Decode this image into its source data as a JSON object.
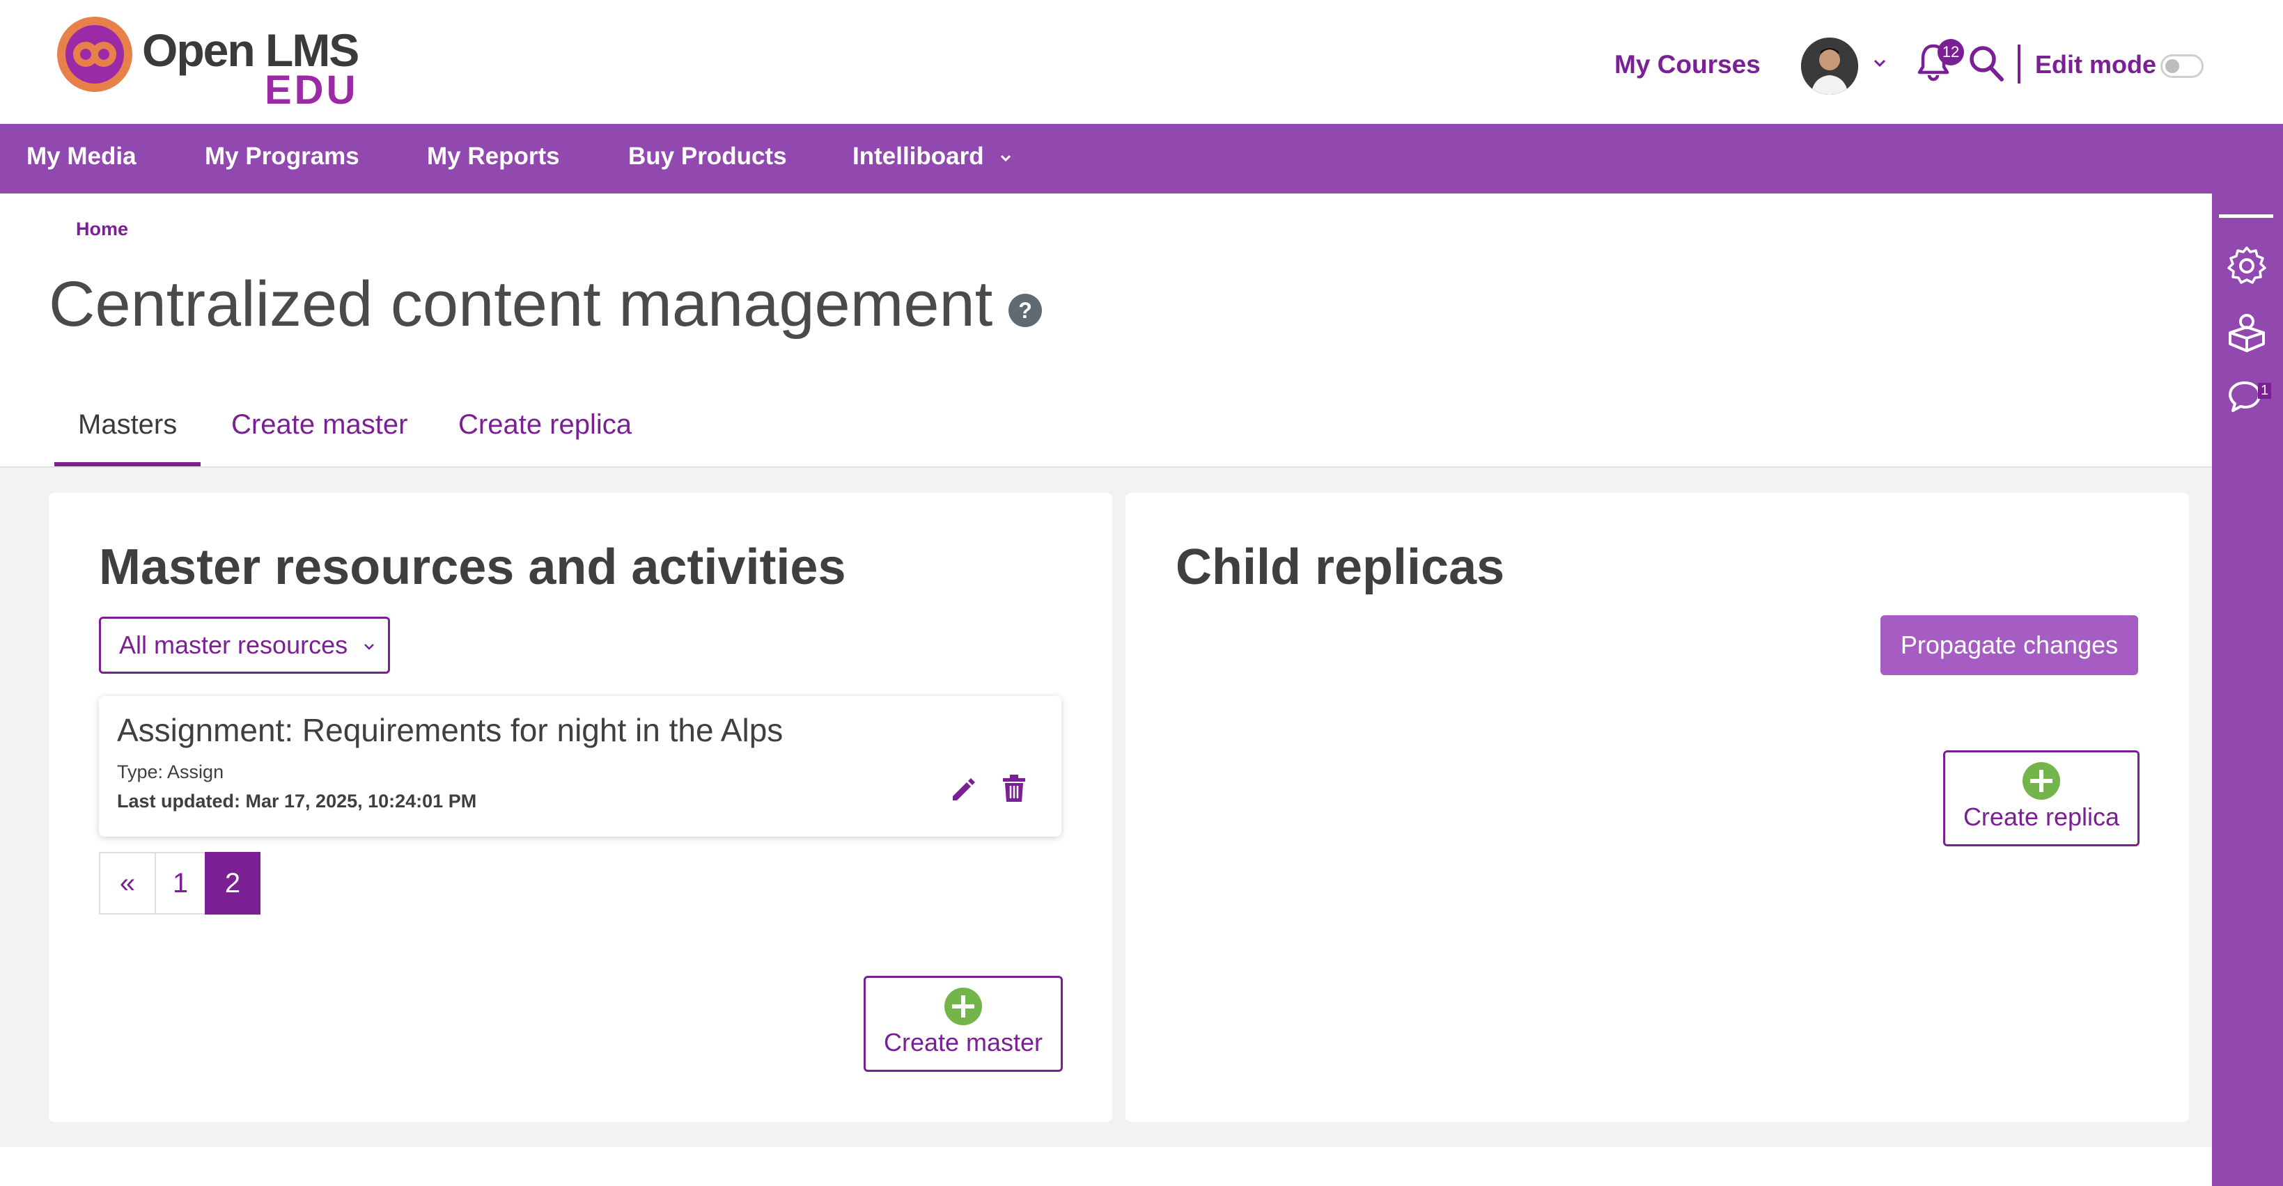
{
  "header": {
    "logo": {
      "text": "Open LMS",
      "sub": "EDU"
    },
    "my_courses": "My Courses",
    "notifications_count": "12",
    "edit_mode_label": "Edit mode",
    "edit_mode_on": false
  },
  "nav": {
    "items": [
      {
        "label": "My Media"
      },
      {
        "label": "My Programs"
      },
      {
        "label": "My Reports"
      },
      {
        "label": "Buy Products"
      },
      {
        "label": "Intelliboard"
      }
    ]
  },
  "drawer": {
    "messages_count": "1"
  },
  "breadcrumb": {
    "home": "Home"
  },
  "page": {
    "title": "Centralized content management",
    "help": "?"
  },
  "tabs": [
    {
      "label": "Masters",
      "active": true
    },
    {
      "label": "Create master",
      "active": false
    },
    {
      "label": "Create replica",
      "active": false
    }
  ],
  "masters": {
    "title": "Master resources and activities",
    "filter": {
      "selected": "All master resources"
    },
    "items": [
      {
        "title": "Assignment: Requirements for night in the Alps",
        "type": "Type: Assign",
        "updated": "Last updated: Mar 17, 2025, 10:24:01 PM"
      }
    ],
    "pagination": {
      "prev": "«",
      "pages": [
        "1",
        "2"
      ],
      "current": "2"
    },
    "create_button": "Create master"
  },
  "replicas": {
    "title": "Child replicas",
    "propagate_button": "Propagate changes",
    "create_button": "Create replica"
  },
  "colors": {
    "brand_purple": "#7a1f94",
    "nav_purple": "#9149af",
    "accent_green": "#74b54b",
    "logo_orange": "#e8804a"
  }
}
